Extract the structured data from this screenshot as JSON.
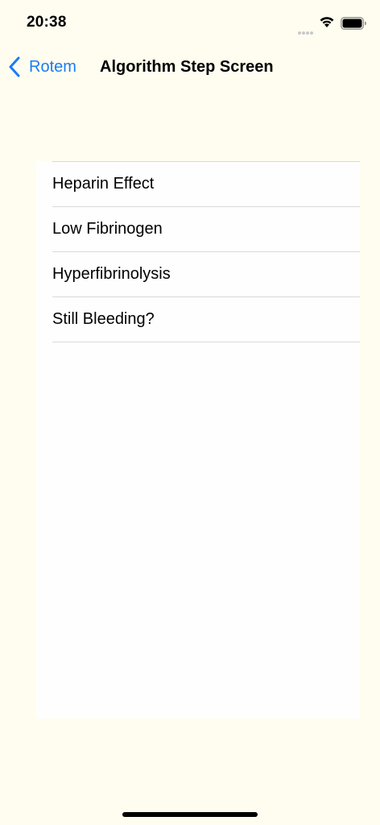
{
  "status_bar": {
    "time": "20:38"
  },
  "nav": {
    "back_label": "Rotem",
    "title": "Algorithm Step Screen"
  },
  "list": {
    "items": [
      {
        "label": "Heparin Effect"
      },
      {
        "label": "Low Fibrinogen"
      },
      {
        "label": "Hyperfibrinolysis"
      },
      {
        "label": "Still Bleeding?"
      }
    ]
  },
  "icons": {
    "wifi": "wifi-icon",
    "battery": "battery-icon",
    "back": "chevron-left-icon"
  },
  "colors": {
    "background": "#fffdf0",
    "accent": "#1a7cf6",
    "panel": "#fefefe",
    "separator": "#d9d9d9"
  }
}
